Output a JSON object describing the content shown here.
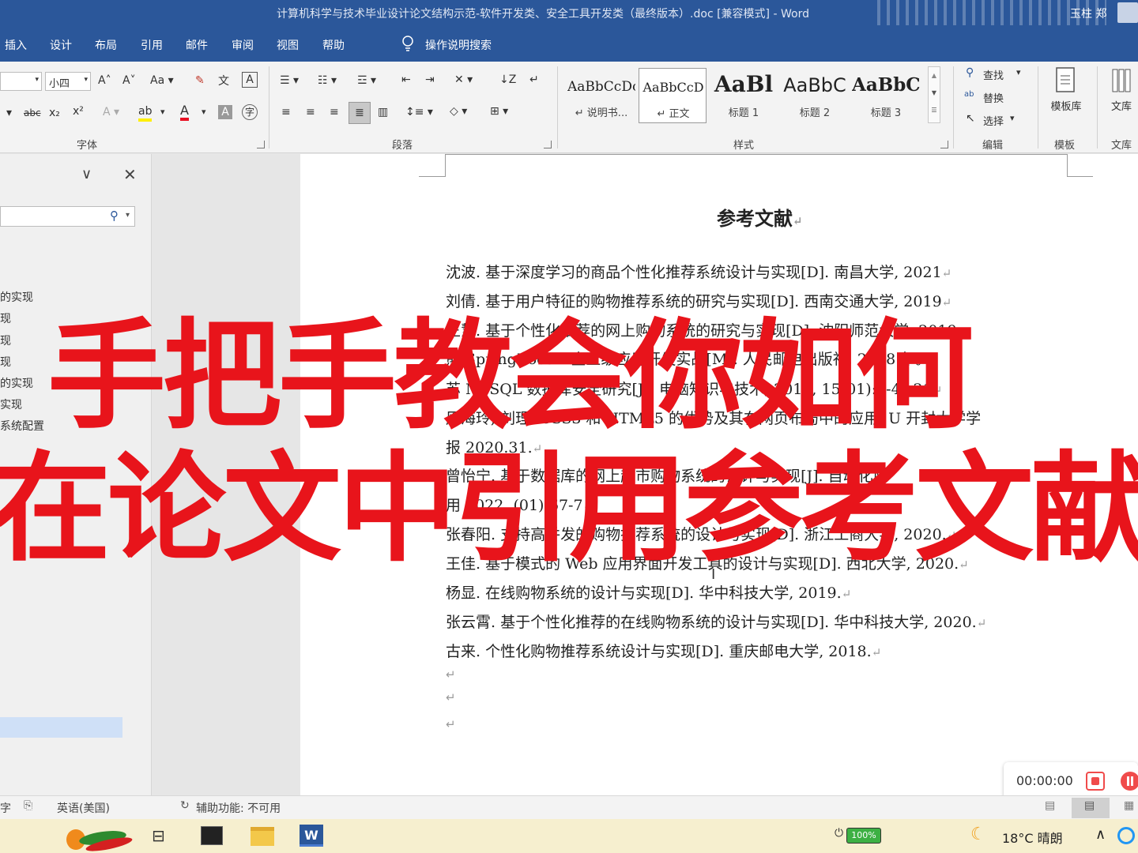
{
  "titlebar": {
    "title": "计算机科学与技术毕业设计论文结构示范-软件开发类、安全工具开发类（最终版本）.doc [兼容模式]  -  Word",
    "user": "玉柱 郑"
  },
  "menu": {
    "tabs": [
      "插入",
      "设计",
      "布局",
      "引用",
      "邮件",
      "审阅",
      "视图",
      "帮助"
    ],
    "tell_me": "操作说明搜索"
  },
  "ribbon": {
    "font_size": "小四",
    "group_font": "字体",
    "group_paragraph": "段落",
    "group_styles": "样式",
    "group_edit": "编辑",
    "group_template": "模板",
    "group_library": "文库",
    "styles": [
      {
        "sample": "AaBbCcDc",
        "name": "↵ 说明书..."
      },
      {
        "sample": "AaBbCcD",
        "name": "↵ 正文"
      },
      {
        "sample": "AaBl",
        "name": "标题 1"
      },
      {
        "sample": "AaBbC",
        "name": "标题 2"
      },
      {
        "sample": "AaBbC",
        "name": "标题 3"
      }
    ],
    "find": "查找",
    "replace": "替换",
    "select": "选择",
    "template_lib": "模板库",
    "library": "文库"
  },
  "navpane": {
    "items": [
      "的实现",
      "现",
      "现",
      "现",
      "的实现",
      "实现",
      "系统配置"
    ]
  },
  "document": {
    "heading": "参考文献",
    "refs": [
      "沈波. 基于深度学习的商品个性化推荐系统设计与实现[D]. 南昌大学, 2021",
      "刘倩. 基于用户特征的购物推荐系统的研究与实现[D]. 西南交通大学, 2019",
      "王慧. 基于个性化推荐的网上购物系统的研究与实现[D]. 沈阳师范大学, 2019",
      "熊 SpringBoot 2 企业级应用开发实战[M]. 人民邮电出版社, 2018 年。",
      "苏 MySQL 数据库安全研究[J]. 电脑知识与技术, 2019, 15(01):3-4+21",
      "周海玲, 刘理. CSS3 和 HTML5 的优势及其在网页布局中的应用. U 开封大学学",
      "报 2020.31.",
      "曾怡宁. 基于数据库的网上超市购物系统的设计与实现[J]. 自动化应",
      "用 2022, (01):67-7",
      "张春阳. 支持高并发的购物推荐系统的设计与实现[D]. 浙江工商大学, 2020.",
      "王佳. 基于模式的 Web 应用界面开发工具的设计与实现[D]. 西北大学, 2020.",
      "杨显. 在线购物系统的设计与实现[D]. 华中科技大学, 2019.",
      "张云霄. 基于个性化推荐的在线购物系统的设计与实现[D]. 华中科技大学, 2020.",
      "古来. 个性化购物推荐系统设计与实现[D]. 重庆邮电大学, 2018."
    ],
    "para_mark": "↵"
  },
  "overlay": {
    "line1": "手把手教会你如何",
    "line2": "在论文中引用参考文献"
  },
  "recorder": {
    "time": "00:00:00"
  },
  "statusbar": {
    "lang": "英语(美国)",
    "accessibility": "辅助功能: 不可用"
  },
  "taskbar": {
    "battery": "100%",
    "weather": "18°C  晴朗"
  },
  "colors": {
    "word_blue": "#2b579a",
    "overlay_red": "#e8141b",
    "recorder_red": "#f04b4b",
    "nav_highlight": "#cfe0f7"
  }
}
